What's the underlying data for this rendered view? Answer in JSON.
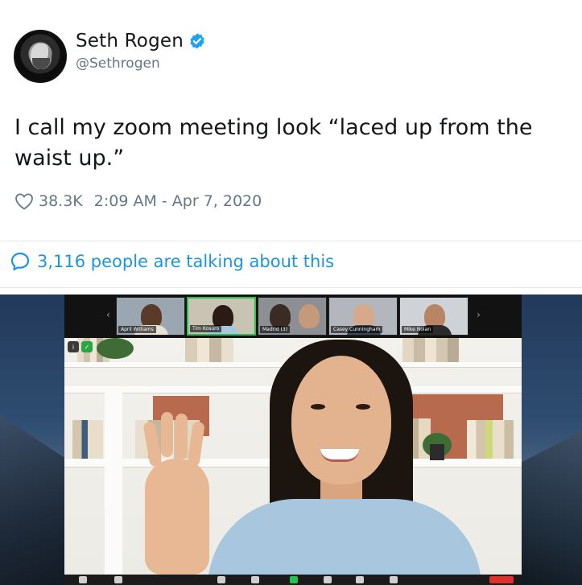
{
  "tweet": {
    "display_name": "Seth Rogen",
    "handle": "@Sethrogen",
    "text": "I call my zoom meeting look “laced up from the waist up.”",
    "likes": "38.3K",
    "timestamp": "2:09 AM - Apr 7, 2020",
    "talking": "3,116 people are talking about this",
    "icons": {
      "avatar": "avatar-photo",
      "verified": "verified-badge-icon",
      "like": "heart-icon",
      "reply": "speech-bubble-icon"
    },
    "colors": {
      "link": "#1b95e0",
      "verified": "#1da1f2",
      "secondary": "#657786"
    }
  },
  "zoom_screenshot": {
    "participants": [
      {
        "name": "April Williams"
      },
      {
        "name": "Tim Kosuro"
      },
      {
        "name": "Madrid (3)"
      },
      {
        "name": "Casey Cunningham"
      },
      {
        "name": "Mike Nolan"
      }
    ],
    "active_index": 1,
    "colors": {
      "active_border": "#24c24a",
      "end_button": "#e0302c"
    }
  }
}
